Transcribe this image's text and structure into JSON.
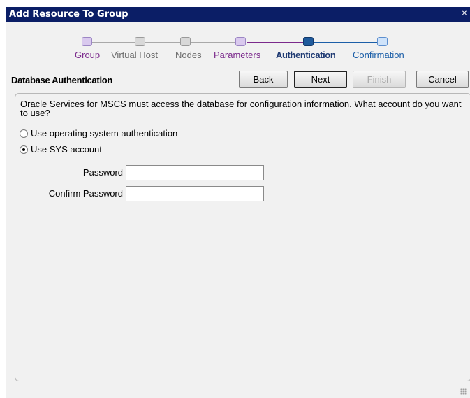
{
  "window": {
    "title": "Add Resource To Group"
  },
  "steps": [
    {
      "label": "Group",
      "state": "done"
    },
    {
      "label": "Virtual Host",
      "state": "inactive"
    },
    {
      "label": "Nodes",
      "state": "inactive"
    },
    {
      "label": "Parameters",
      "state": "done"
    },
    {
      "label": "Authentication",
      "state": "current"
    },
    {
      "label": "Confirmation",
      "state": "pending"
    }
  ],
  "header": {
    "title": "Database Authentication"
  },
  "buttons": {
    "back": "Back",
    "next": "Next",
    "finish": "Finish",
    "cancel": "Cancel"
  },
  "content": {
    "intro": "Oracle Services for MSCS must access the database for configuration information.  What account do you want to use?",
    "option_os": "Use operating system authentication",
    "option_sys": "Use SYS account",
    "selected_option": "Use SYS account",
    "password_label": "Password",
    "confirm_label": "Confirm Password",
    "password_value": "",
    "confirm_value": ""
  },
  "colors": {
    "title_bar": "#0b1e66",
    "step_done": "#7b2a8c",
    "step_current": "#1f3a73",
    "step_pending": "#1c5fa8",
    "step_inactive": "#6b6b6b"
  }
}
